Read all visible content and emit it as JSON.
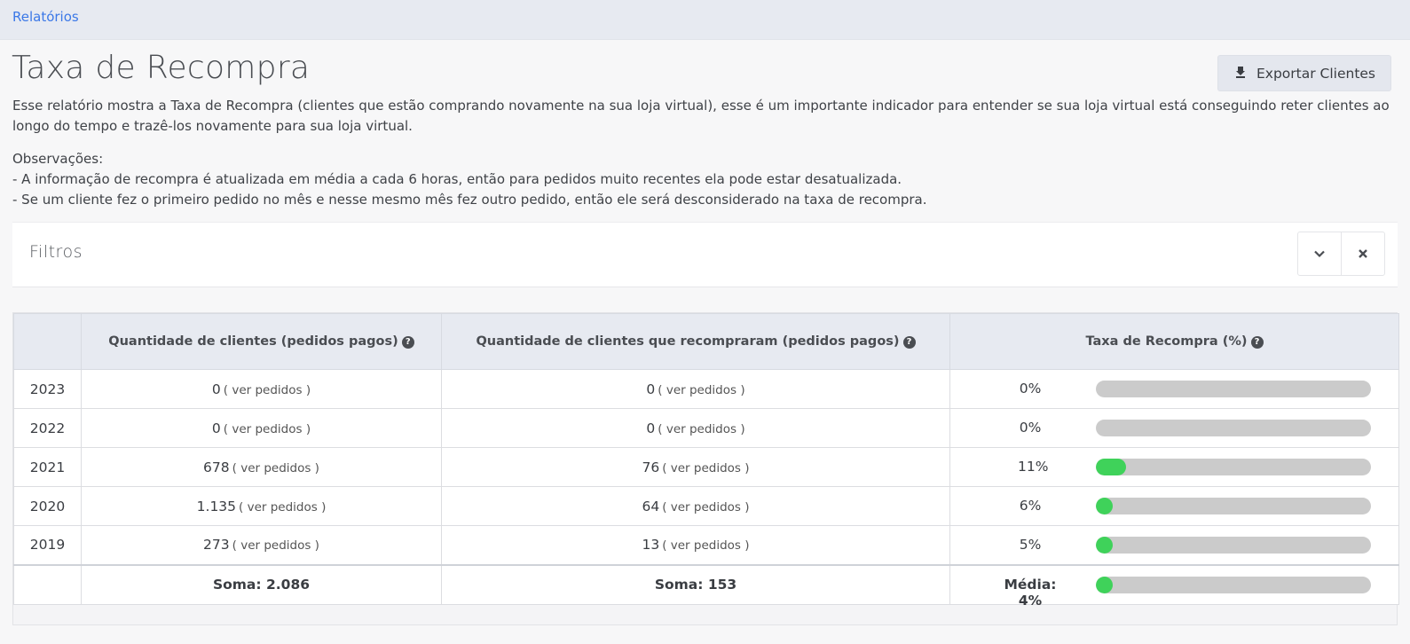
{
  "breadcrumb": "Relatórios",
  "title": "Taxa de Recompra",
  "export_label": "Exportar Clientes",
  "description": "Esse relatório mostra a Taxa de Recompra (clientes que estão comprando novamente na sua loja virtual), esse é um importante indicador para entender se sua loja virtual está conseguindo reter clientes ao longo do tempo e trazê-los novamente para sua loja virtual.",
  "observations": {
    "heading": "Observações:",
    "items": [
      "- A informação de recompra é atualizada em média a cada 6 horas, então para pedidos muito recentes ela pode estar desatualizada.",
      "- Se um cliente fez o primeiro pedido no mês e nesse mesmo mês fez outro pedido, então ele será desconsiderado na taxa de recompra."
    ]
  },
  "filters": {
    "title": "Filtros"
  },
  "table": {
    "headers": {
      "year": "",
      "clients": "Quantidade de clientes (pedidos pagos)",
      "rebuyers": "Quantidade de clientes que recompraram (pedidos pagos)",
      "rate": "Taxa de Recompra (%)"
    },
    "ver_label": "( ver pedidos )",
    "rows": [
      {
        "year": "2023",
        "clients": "0",
        "rebuyers": "0",
        "rate": "0%",
        "rate_pct": 0
      },
      {
        "year": "2022",
        "clients": "0",
        "rebuyers": "0",
        "rate": "0%",
        "rate_pct": 0
      },
      {
        "year": "2021",
        "clients": "678",
        "rebuyers": "76",
        "rate": "11%",
        "rate_pct": 11
      },
      {
        "year": "2020",
        "clients": "1.135",
        "rebuyers": "64",
        "rate": "6%",
        "rate_pct": 6
      },
      {
        "year": "2019",
        "clients": "273",
        "rebuyers": "13",
        "rate": "5%",
        "rate_pct": 5
      }
    ],
    "totals": {
      "clients": "Soma: 2.086",
      "rebuyers": "Soma: 153",
      "rate": "Média: 4%",
      "rate_pct": 4
    }
  },
  "colors": {
    "accent_link": "#3b78e7",
    "bar_fill": "#3fd25a",
    "bar_track": "#cbcbcb",
    "header_bg": "#e7eaf1"
  }
}
